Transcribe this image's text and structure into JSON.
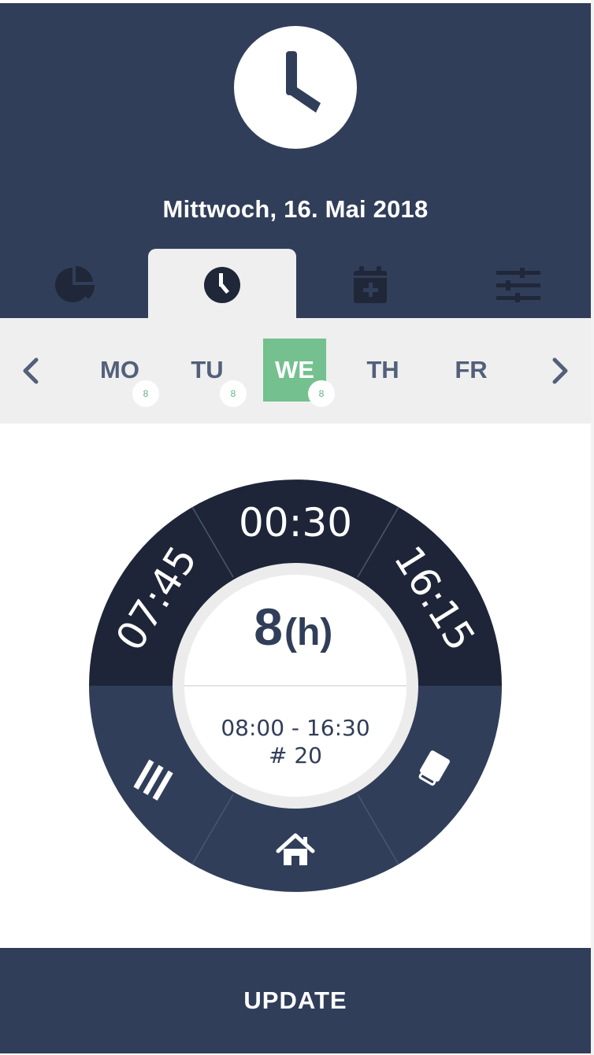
{
  "app": {
    "header_logo": "clock-icon"
  },
  "header": {
    "date": "Mittwoch, 16. Mai 2018"
  },
  "tabs": [
    {
      "icon": "pie-chart-icon",
      "active": false
    },
    {
      "icon": "clock-icon",
      "active": true
    },
    {
      "icon": "calendar-plus-icon",
      "active": false
    },
    {
      "icon": "sliders-icon",
      "active": false
    }
  ],
  "week": {
    "prev_icon": "chevron-left-icon",
    "next_icon": "chevron-right-icon",
    "days": [
      {
        "label": "MO",
        "badge": "8"
      },
      {
        "label": "TU",
        "badge": "8"
      },
      {
        "label": "WE",
        "badge": "8",
        "active": true
      },
      {
        "label": "TH",
        "badge": ""
      },
      {
        "label": "FR",
        "badge": ""
      }
    ]
  },
  "dial": {
    "break": "00:30",
    "start": "07:45",
    "end": "16:15",
    "hours": "8",
    "hours_unit": "(h)",
    "range": "08:00 - 16:30",
    "id": "# 20",
    "bottom_left_icon": "stripes-icon",
    "bottom_center_icon": "home-icon",
    "bottom_right_icon": "eraser-icon",
    "colors": {
      "top": "#1e2538",
      "bottom": "#313e59"
    }
  },
  "footer": {
    "update_label": "UPDATE"
  }
}
